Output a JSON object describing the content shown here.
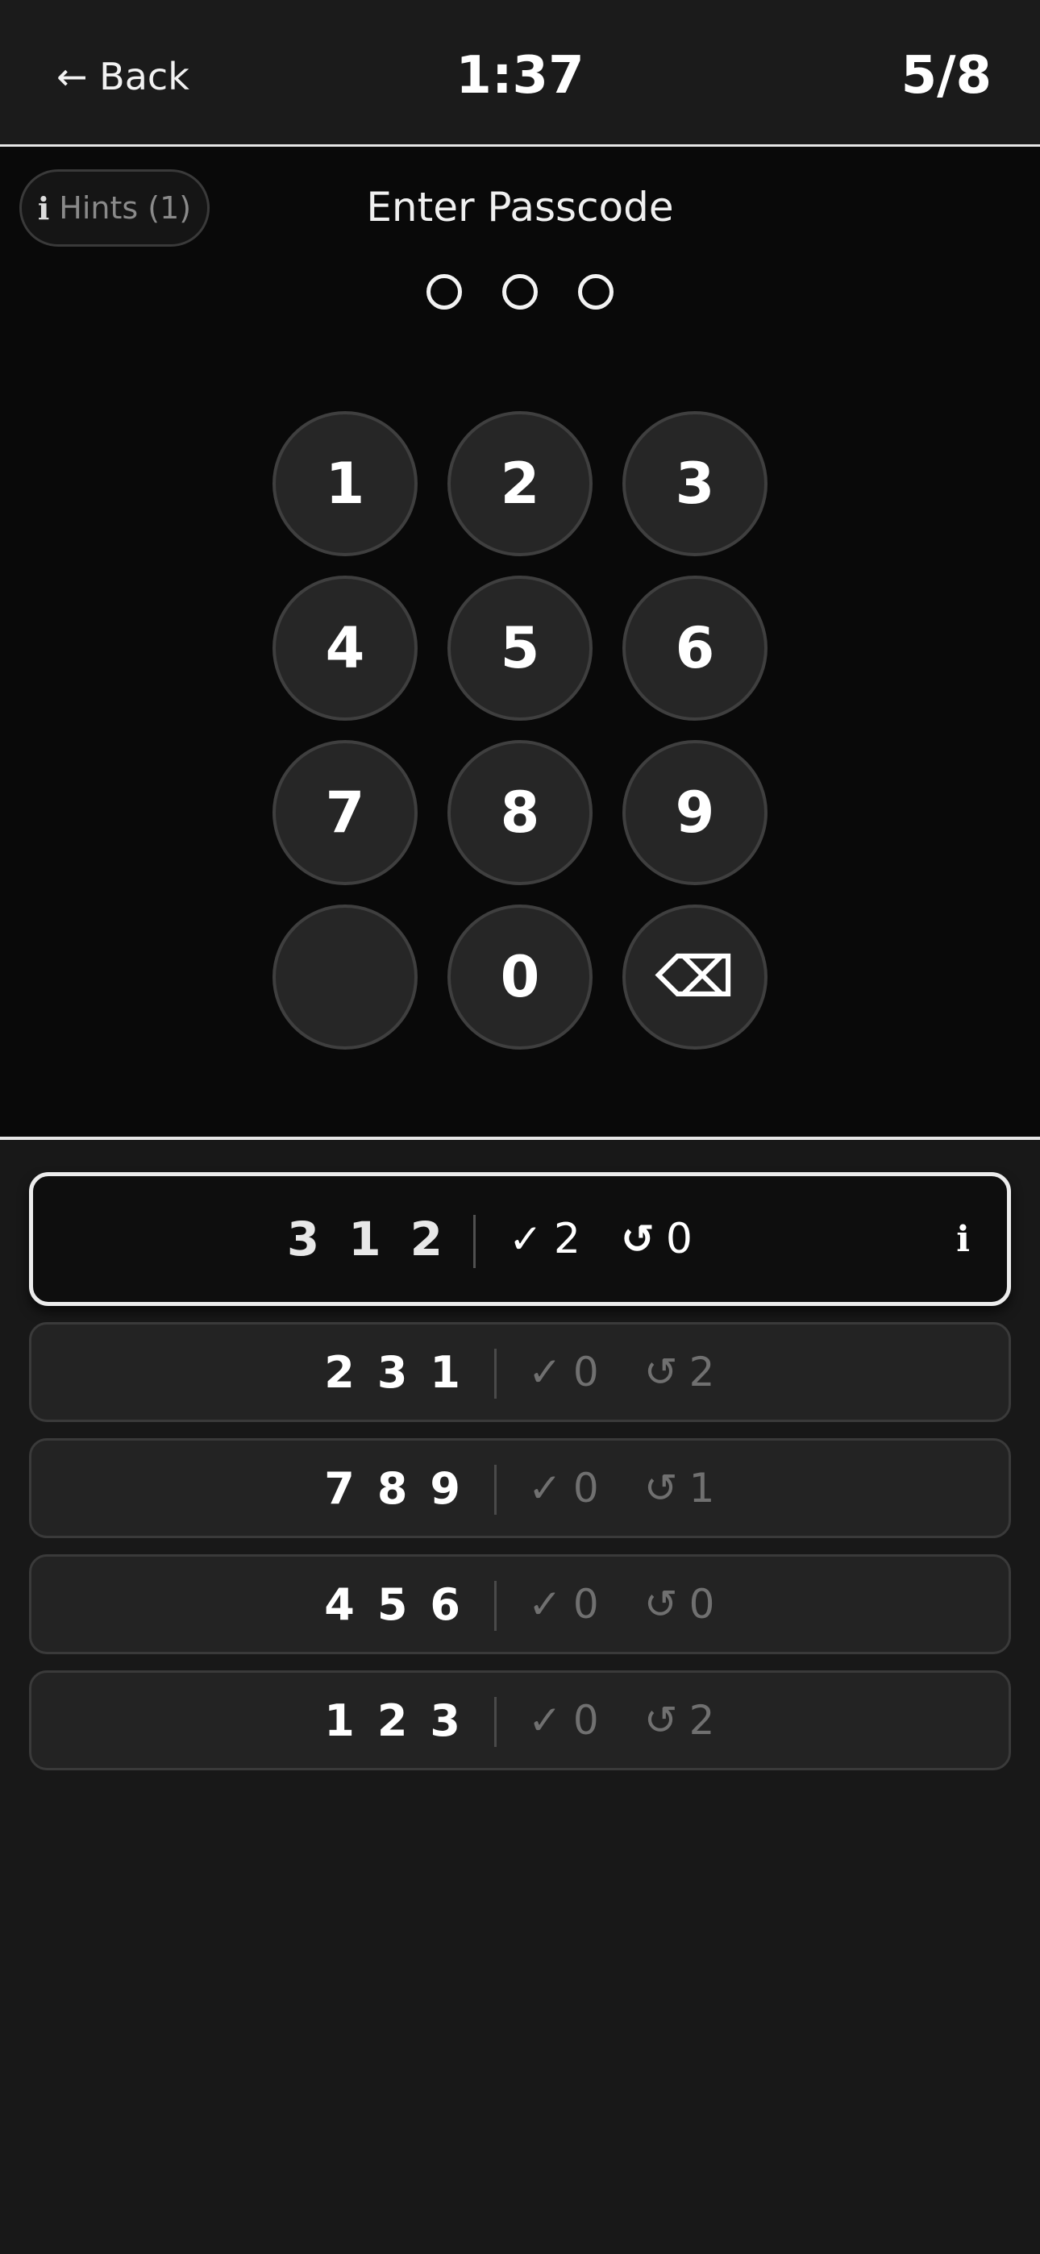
{
  "header": {
    "back_label": "← Back",
    "timer": "1:37",
    "level": "5/8"
  },
  "hints": {
    "icon": "i",
    "label": "Hints (1)"
  },
  "prompt": "Enter Passcode",
  "passcode": {
    "length": 3,
    "filled": 0
  },
  "keypad": {
    "keys": [
      "1",
      "2",
      "3",
      "4",
      "5",
      "6",
      "7",
      "8",
      "9",
      "",
      "0",
      "⌫"
    ]
  },
  "guesses": [
    {
      "digits": [
        "3",
        "1",
        "2"
      ],
      "correct_icon": "✓",
      "correct": "2",
      "misplaced_icon": "↺",
      "misplaced": "0",
      "info_icon": "i"
    },
    {
      "digits": [
        "2",
        "3",
        "1"
      ],
      "correct_icon": "✓",
      "correct": "0",
      "misplaced_icon": "↺",
      "misplaced": "2"
    },
    {
      "digits": [
        "7",
        "8",
        "9"
      ],
      "correct_icon": "✓",
      "correct": "0",
      "misplaced_icon": "↺",
      "misplaced": "1"
    },
    {
      "digits": [
        "4",
        "5",
        "6"
      ],
      "correct_icon": "✓",
      "correct": "0",
      "misplaced_icon": "↺",
      "misplaced": "0"
    },
    {
      "digits": [
        "1",
        "2",
        "3"
      ],
      "correct_icon": "✓",
      "correct": "0",
      "misplaced_icon": "↺",
      "misplaced": "2"
    }
  ],
  "colors": {
    "background": "#181818",
    "keypad_background": "#090909",
    "key_fill": "#262626",
    "accent": "#ffffff",
    "muted": "#707070"
  }
}
